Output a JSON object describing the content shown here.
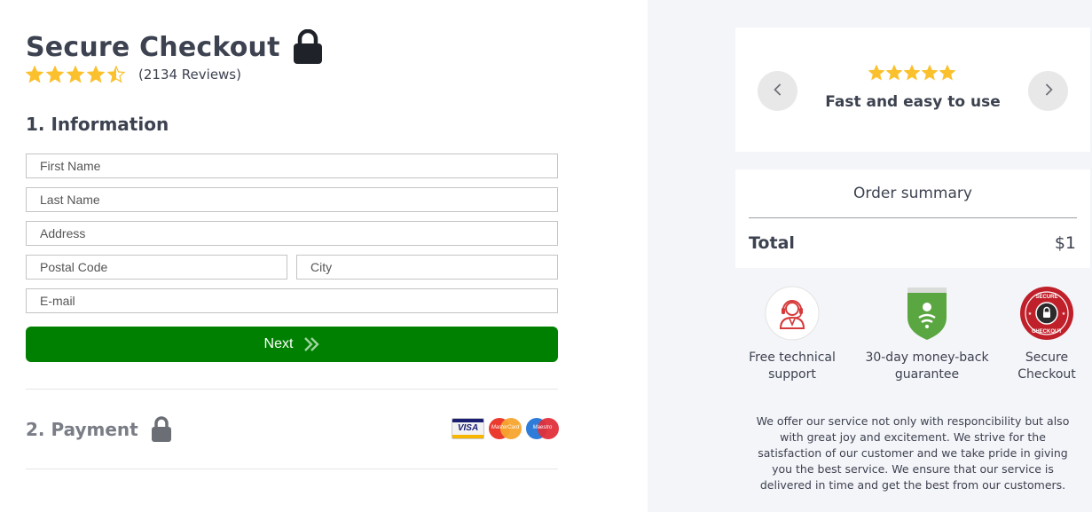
{
  "header": {
    "title": "Secure Checkout",
    "rating_value": 4.5,
    "rating_max": 5,
    "reviews_text": "(2134 Reviews)"
  },
  "information": {
    "section_title": "1. Information",
    "fields": {
      "first_name_placeholder": "First Name",
      "last_name_placeholder": "Last Name",
      "address_placeholder": "Address",
      "postal_code_placeholder": "Postal Code",
      "city_placeholder": "City",
      "email_placeholder": "E-mail"
    },
    "next_label": "Next"
  },
  "payment": {
    "section_title": "2. Payment",
    "cards": [
      "VISA",
      "MasterCard",
      "Maestro"
    ]
  },
  "testimonial": {
    "stars": 5,
    "text": "Fast and easy to use"
  },
  "order_summary": {
    "title": "Order summary",
    "total_label": "Total",
    "total_value": "$1"
  },
  "features": [
    {
      "label": "Free technical support",
      "icon": "support-agent-icon"
    },
    {
      "label": "30-day money-back guarantee",
      "icon": "shield-icon"
    },
    {
      "label": "Secure Checkout",
      "icon": "secure-checkout-badge-icon"
    }
  ],
  "badge_text": {
    "top": "SECURE",
    "bottom": "CHECKOUT"
  },
  "about_text": "We offer our service not only with responcibility but also with great joy and excitement. We strive for the satisfaction of our customer and we take pride in giving you the best service. We ensure that our service is delivered in time and get the best from our customers.",
  "colors": {
    "accent_green": "#008000",
    "star_yellow": "#fbc02d",
    "text_dark": "#3d4250",
    "panel_bg": "#f4f5f9",
    "shield_green": "#5aa641",
    "badge_red": "#c0202a"
  }
}
